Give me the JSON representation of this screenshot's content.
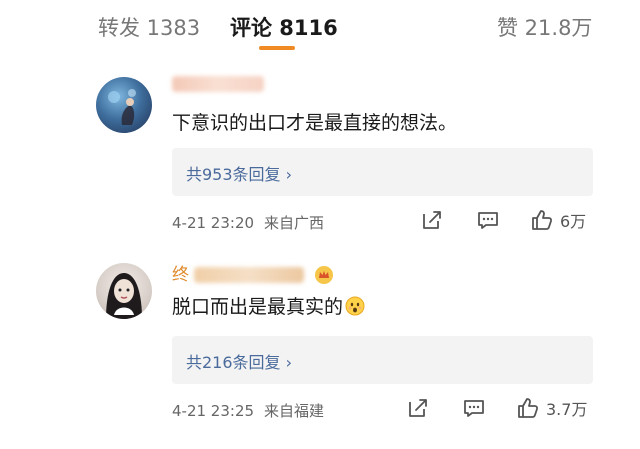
{
  "tabs": {
    "repost": "转发 1383",
    "comment": "评论 8116",
    "like": "赞 21.8万"
  },
  "comments": [
    {
      "text": "下意识的出口才是最直接的想法。",
      "replies": "共953条回复 ›",
      "date": "4-21 23:20",
      "location": "来自广西",
      "likes": "6万"
    },
    {
      "username": "终",
      "text": "脱口而出是最真实的",
      "emoji": "face-emoji",
      "replies": "共216条回复 ›",
      "date": "4-21 23:25",
      "location": "来自福建",
      "likes": "3.7万"
    }
  ],
  "colors": {
    "accent": "#f08a24",
    "username": "#e08a2a",
    "reply_link": "#4a6a9c",
    "reply_bg": "#f3f3f3"
  },
  "icons": [
    "share-icon",
    "comment-icon",
    "thumbs-up-icon",
    "crown-badge-icon"
  ]
}
